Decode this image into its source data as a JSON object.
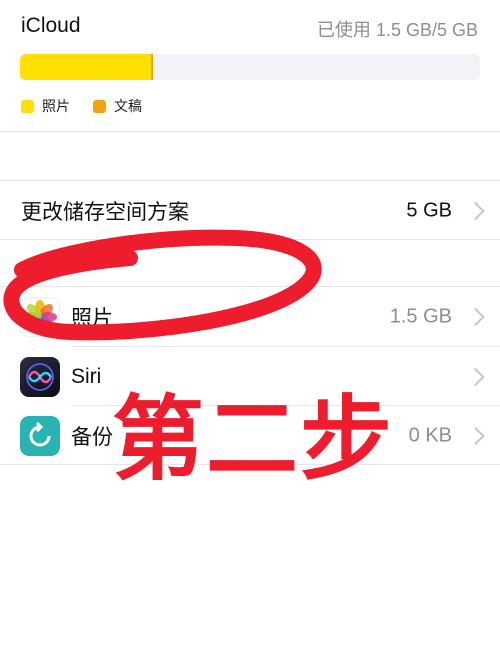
{
  "header": {
    "title": "iCloud",
    "usage": "已使用 1.5 GB/5 GB"
  },
  "storage": {
    "photos_fraction": 0.285,
    "docs_fraction": 0.004,
    "legend": [
      {
        "label": "照片",
        "color": "#ffe000"
      },
      {
        "label": "文稿",
        "color": "#f2a30f"
      }
    ]
  },
  "plan": {
    "label": "更改储存空间方案",
    "value": "5 GB"
  },
  "apps": [
    {
      "name": "照片",
      "value": "1.5 GB",
      "icon": "photos-icon"
    },
    {
      "name": "Siri",
      "value": "",
      "icon": "siri-icon"
    },
    {
      "name": "备份",
      "value": "0 KB",
      "icon": "backup-icon"
    }
  ],
  "annotation": {
    "text": "第二步",
    "color": "#ee1d2d"
  }
}
